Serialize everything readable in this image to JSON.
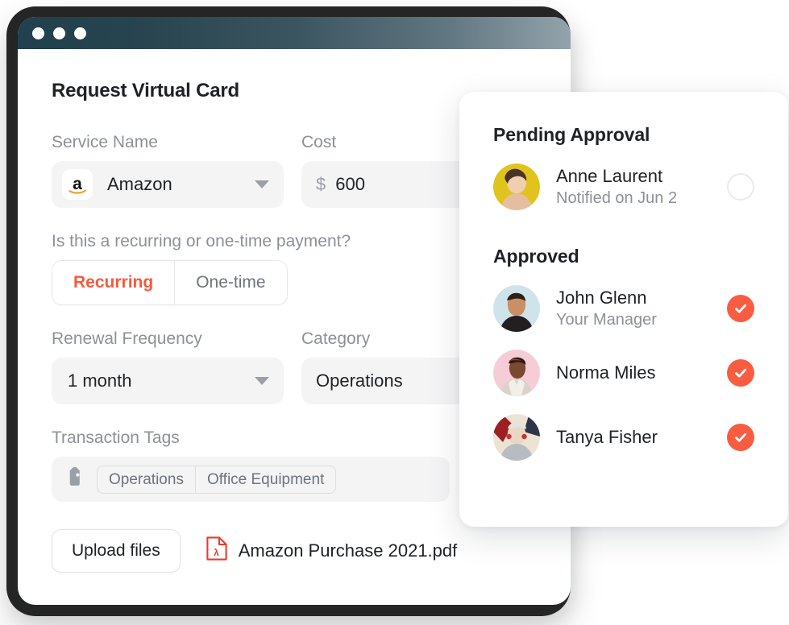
{
  "window": {
    "traffic_lights": [
      "close",
      "minimize",
      "zoom"
    ],
    "titlebar_gradient_from": "#20414e",
    "titlebar_gradient_to": "#93a3ab"
  },
  "form": {
    "title": "Request Virtual Card",
    "service": {
      "label": "Service Name",
      "value": "Amazon",
      "brand_icon": "amazon-logo-icon",
      "caret_icon": "chevron-down-icon"
    },
    "cost": {
      "label": "Cost",
      "currency": "$",
      "value": "600"
    },
    "payment_type": {
      "question": "Is this a recurring or one-time payment?",
      "options": [
        "Recurring",
        "One-time"
      ],
      "selected": "Recurring",
      "active_color": "#f75a3e"
    },
    "renewal": {
      "label": "Renewal Frequency",
      "value": "1 month",
      "caret_icon": "chevron-down-icon"
    },
    "category": {
      "label": "Category",
      "value": "Operations"
    },
    "tags": {
      "label": "Transaction Tags",
      "icon": "tag-icon",
      "chips": [
        "Operations",
        "Office Equipment"
      ]
    },
    "upload": {
      "button_label": "Upload files",
      "attachment_name": "Amazon Purchase 2021.pdf",
      "attachment_icon": "pdf-file-icon"
    }
  },
  "approval_panel": {
    "pending": {
      "heading": "Pending Approval",
      "people": [
        {
          "name": "Anne Laurent",
          "subtitle": "Notified on Jun 2",
          "status": "pending",
          "avatar_bg": "#e0c31d",
          "avatar_name": "avatar-anne-laurent"
        }
      ]
    },
    "approved": {
      "heading": "Approved",
      "approved_color": "#fa5c42",
      "people": [
        {
          "name": "John Glenn",
          "subtitle": "Your Manager",
          "status": "approved",
          "avatar_bg": "#cfe3ea",
          "avatar_name": "avatar-john-glenn"
        },
        {
          "name": "Norma Miles",
          "subtitle": "",
          "status": "approved",
          "avatar_bg": "#f6cdd6",
          "avatar_name": "avatar-norma-miles"
        },
        {
          "name": "Tanya Fisher",
          "subtitle": "",
          "status": "approved",
          "avatar_bg": "#e7ded0",
          "avatar_name": "avatar-tanya-fisher"
        }
      ]
    }
  }
}
